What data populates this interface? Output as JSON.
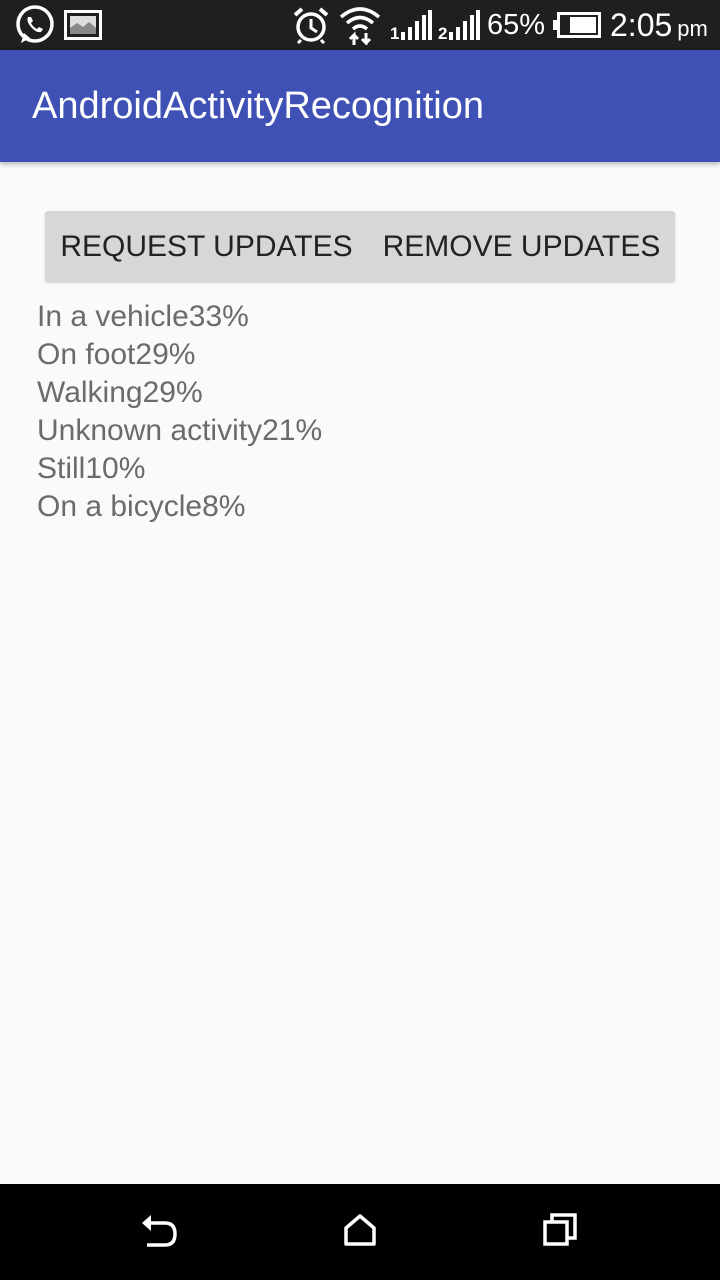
{
  "status_bar": {
    "battery_percent": "65%",
    "time": "2:05",
    "time_suffix": "pm",
    "icons": [
      "whatsapp-icon",
      "image-notification-icon",
      "alarm-icon",
      "wifi-icon",
      "signal-sim1-icon",
      "signal-sim2-icon",
      "battery-icon"
    ]
  },
  "app_bar": {
    "title": "AndroidActivityRecognition",
    "color": "#3f51b5"
  },
  "buttons": {
    "request_updates": "REQUEST UPDATES",
    "remove_updates": "REMOVE UPDATES"
  },
  "activities": [
    {
      "name": "In a vehicle",
      "confidence": "33%"
    },
    {
      "name": "On foot",
      "confidence": "29%"
    },
    {
      "name": "Walking",
      "confidence": "29%"
    },
    {
      "name": "Unknown activity",
      "confidence": "21%"
    },
    {
      "name": "Still",
      "confidence": "10%"
    },
    {
      "name": "On a bicycle",
      "confidence": "8%"
    }
  ],
  "nav_bar": {
    "icons": [
      "back-icon",
      "home-icon",
      "recents-icon"
    ]
  }
}
